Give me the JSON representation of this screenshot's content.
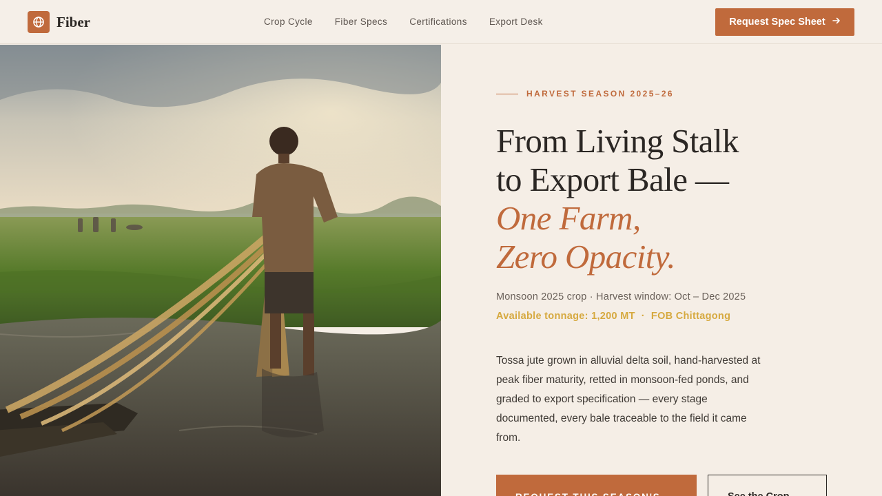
{
  "header": {
    "brand_name": "Fiber",
    "brand_icon": "globe-icon",
    "nav": [
      {
        "label": "Crop Cycle"
      },
      {
        "label": "Fiber Specs"
      },
      {
        "label": "Certifications"
      },
      {
        "label": "Export Desk"
      }
    ],
    "cta_label": "Request Spec Sheet",
    "cta_icon": "arrow-right-icon"
  },
  "hero": {
    "image_alt": "Farmer standing in flooded field holding wet jute fiber bundles",
    "eyebrow": "HARVEST SEASON 2025–26",
    "headline": {
      "line1": "From Living Stalk",
      "line2": "to Export Bale —",
      "accent1": "One Farm,",
      "accent2": "Zero Opacity."
    },
    "meta_line": "Monsoon 2025 crop · Harvest window: Oct – Dec 2025",
    "tonnage": "Available tonnage: 1,200 MT",
    "separator": "·",
    "fob": "FOB Chittagong",
    "body": "Tossa jute grown in alluvial delta soil, hand-harvested at peak fiber maturity, retted in monsoon-fed ponds, and graded to export specification — every stage documented, every bale traceable to the field it came from.",
    "primary_button": "REQUEST THIS SEASON'S",
    "secondary_button": "See the Crop"
  },
  "colors": {
    "accent": "#c06a3c",
    "gold": "#d6a93f",
    "background": "#f5eee6",
    "text": "#2b2724"
  }
}
